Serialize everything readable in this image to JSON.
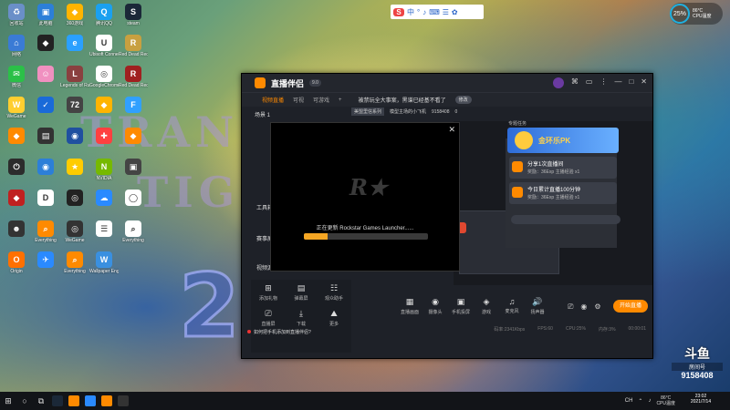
{
  "desktop": {
    "icons": [
      {
        "label": "回收站",
        "color": "#6a8fc8",
        "glyph": "♻"
      },
      {
        "label": "此电脑",
        "color": "#2c7fd8",
        "glyph": "▣"
      },
      {
        "label": "360游戏",
        "color": "#ffb400",
        "glyph": "◆"
      },
      {
        "label": "腾讯QQ",
        "color": "#1aa0f0",
        "glyph": "Q"
      },
      {
        "label": "steam",
        "color": "#1b2838",
        "glyph": "S"
      },
      {
        "label": "网络",
        "color": "#3a7bd5",
        "glyph": "⌂"
      },
      {
        "label": "",
        "color": "#222",
        "glyph": "◆"
      },
      {
        "label": "",
        "color": "#2aa0ff",
        "glyph": "e"
      },
      {
        "label": "Ubisoft Connect",
        "color": "#fff",
        "glyph": "U"
      },
      {
        "label": "Red Dead Redemption",
        "color": "#c8a040",
        "glyph": "R"
      },
      {
        "label": "微信",
        "color": "#2bc048",
        "glyph": "✉"
      },
      {
        "label": "",
        "color": "#f090c0",
        "glyph": "☺"
      },
      {
        "label": "Legends of Runeterra",
        "color": "#8a4040",
        "glyph": "L"
      },
      {
        "label": "GoogleChrome",
        "color": "#fff",
        "glyph": "◎"
      },
      {
        "label": "Red Dead Redemption 2",
        "color": "#a02020",
        "glyph": "R"
      },
      {
        "label": "WeGame",
        "color": "#ffce30",
        "glyph": "W"
      },
      {
        "label": "",
        "color": "#1a6ad8",
        "glyph": "✓"
      },
      {
        "label": "",
        "color": "#444",
        "glyph": "72"
      },
      {
        "label": "",
        "color": "#ffb400",
        "glyph": "◆"
      },
      {
        "label": "",
        "color": "#30a0ff",
        "glyph": "F"
      },
      {
        "label": "",
        "color": "#ff8a00",
        "glyph": "◆"
      },
      {
        "label": "",
        "color": "#333",
        "glyph": "▤"
      },
      {
        "label": "",
        "color": "#2050a0",
        "glyph": "◉"
      },
      {
        "label": "",
        "color": "#ff4040",
        "glyph": "✚"
      },
      {
        "label": "",
        "color": "#ff8a00",
        "glyph": "◆"
      },
      {
        "label": "",
        "color": "#2c2c2c",
        "glyph": "⏻"
      },
      {
        "label": "",
        "color": "#2c7fd8",
        "glyph": "◉"
      },
      {
        "label": "",
        "color": "#ffcc00",
        "glyph": "★"
      },
      {
        "label": "NVIDIA",
        "color": "#76b900",
        "glyph": "N"
      },
      {
        "label": "",
        "color": "#444",
        "glyph": "▣"
      },
      {
        "label": "",
        "color": "#c02020",
        "glyph": "◆"
      },
      {
        "label": "",
        "color": "#fff",
        "glyph": "D"
      },
      {
        "label": "",
        "color": "#222",
        "glyph": "◎"
      },
      {
        "label": "",
        "color": "#2a8aff",
        "glyph": "☁"
      },
      {
        "label": "",
        "color": "#fff",
        "glyph": "◯"
      },
      {
        "label": "",
        "color": "#333",
        "glyph": "☻"
      },
      {
        "label": "Everything",
        "color": "#ff8a00",
        "glyph": "⌕"
      },
      {
        "label": "WeGame",
        "color": "#333",
        "glyph": "◎"
      },
      {
        "label": "",
        "color": "#fff",
        "glyph": "☰"
      },
      {
        "label": "Everything",
        "color": "#fff",
        "glyph": "⌕"
      },
      {
        "label": "Origin",
        "color": "#ff7000",
        "glyph": "O"
      },
      {
        "label": "",
        "color": "#2a8aff",
        "glyph": "✈"
      },
      {
        "label": "Everything",
        "color": "#ff8a00",
        "glyph": "⌕"
      },
      {
        "label": "Wallpaper Engine",
        "color": "#3a90e0",
        "glyph": "W"
      }
    ]
  },
  "topbar": {
    "ime_logo": "S",
    "ime_items": [
      "中",
      "°",
      "♪",
      "⌨",
      "☰",
      "✿"
    ],
    "cpu_percent": "25%",
    "cpu_temp": "86°C",
    "cpu_label": "CPU温度"
  },
  "app": {
    "name": "直播伴侣",
    "version_badge": "9.0",
    "title_ctrls": [
      "⌘",
      "▭",
      "⋮",
      "—",
      "□",
      "✕"
    ],
    "tabs": [
      "视频直播",
      "可视",
      "可游戏"
    ],
    "add_tab": "+",
    "notice": "被禁玩全大事案，黑谱已经基不看了",
    "notice_pill": "修改",
    "info_tags": [
      "美盟里信系列"
    ],
    "info_text": "模型主场的小飞机",
    "room_id": "9158408",
    "online": "0",
    "scene_head": "场景 1",
    "tool_labels": [
      "工具箱",
      "赛事屏幕",
      "视频源"
    ],
    "bottom_left": [
      {
        "icon": "⊞",
        "label": "添加礼物"
      },
      {
        "icon": "▤",
        "label": "弹幕屏"
      },
      {
        "icon": "☷",
        "label": "观众助手"
      },
      {
        "icon": "⎚",
        "label": "直播屏"
      },
      {
        "icon": "⤓",
        "label": "下载"
      },
      {
        "icon": "⛰",
        "label": "更多"
      }
    ],
    "bottom_notice": "如何把手机添加到直播伴侣?",
    "side_tag": "专题任务",
    "banner_text": "金环乐PK",
    "tasks": [
      {
        "title": "分享1次直播间",
        "sub": "奖励：36Exp 主播经验 x1"
      },
      {
        "title": "今日累计直播100分钟",
        "sub": "奖励：36Exp 主播经验 x1"
      }
    ],
    "toolbar": [
      {
        "icon": "▦",
        "label": "直播画面"
      },
      {
        "icon": "◉",
        "label": "摄像头"
      },
      {
        "icon": "▣",
        "label": "手机投屏"
      },
      {
        "icon": "◈",
        "label": "游戏"
      },
      {
        "icon": "♫",
        "label": "麦克风"
      },
      {
        "icon": "🔊",
        "label": "扬声器"
      }
    ],
    "mini_ctrls": [
      "⎚",
      "◉",
      "⚙"
    ],
    "live_button": "开始直播",
    "status": [
      "码率:2341Kbps",
      "FPS:60",
      "CPU:25%",
      "内存:3%",
      "00:00:01"
    ]
  },
  "dialog": {
    "close": "✕",
    "logo": "R★",
    "message": "正在更新 Rockstar Games Launcher......",
    "progress": 0.19
  },
  "watermark": {
    "logo": "斗鱼",
    "room_label": "房间号",
    "room": "9158408"
  },
  "taskbar": {
    "start": "⊞",
    "search": "○",
    "taskview": "⧉",
    "apps": [
      "#1b2838",
      "#ff8a00",
      "#2a8aff",
      "#ff8a00",
      "#333"
    ],
    "tray_items": [
      "CH",
      "⌃",
      "♪"
    ],
    "weather_temp": "86°C",
    "weather_label": "CPU温度",
    "time": "23:02",
    "date": "2021/7/14"
  }
}
